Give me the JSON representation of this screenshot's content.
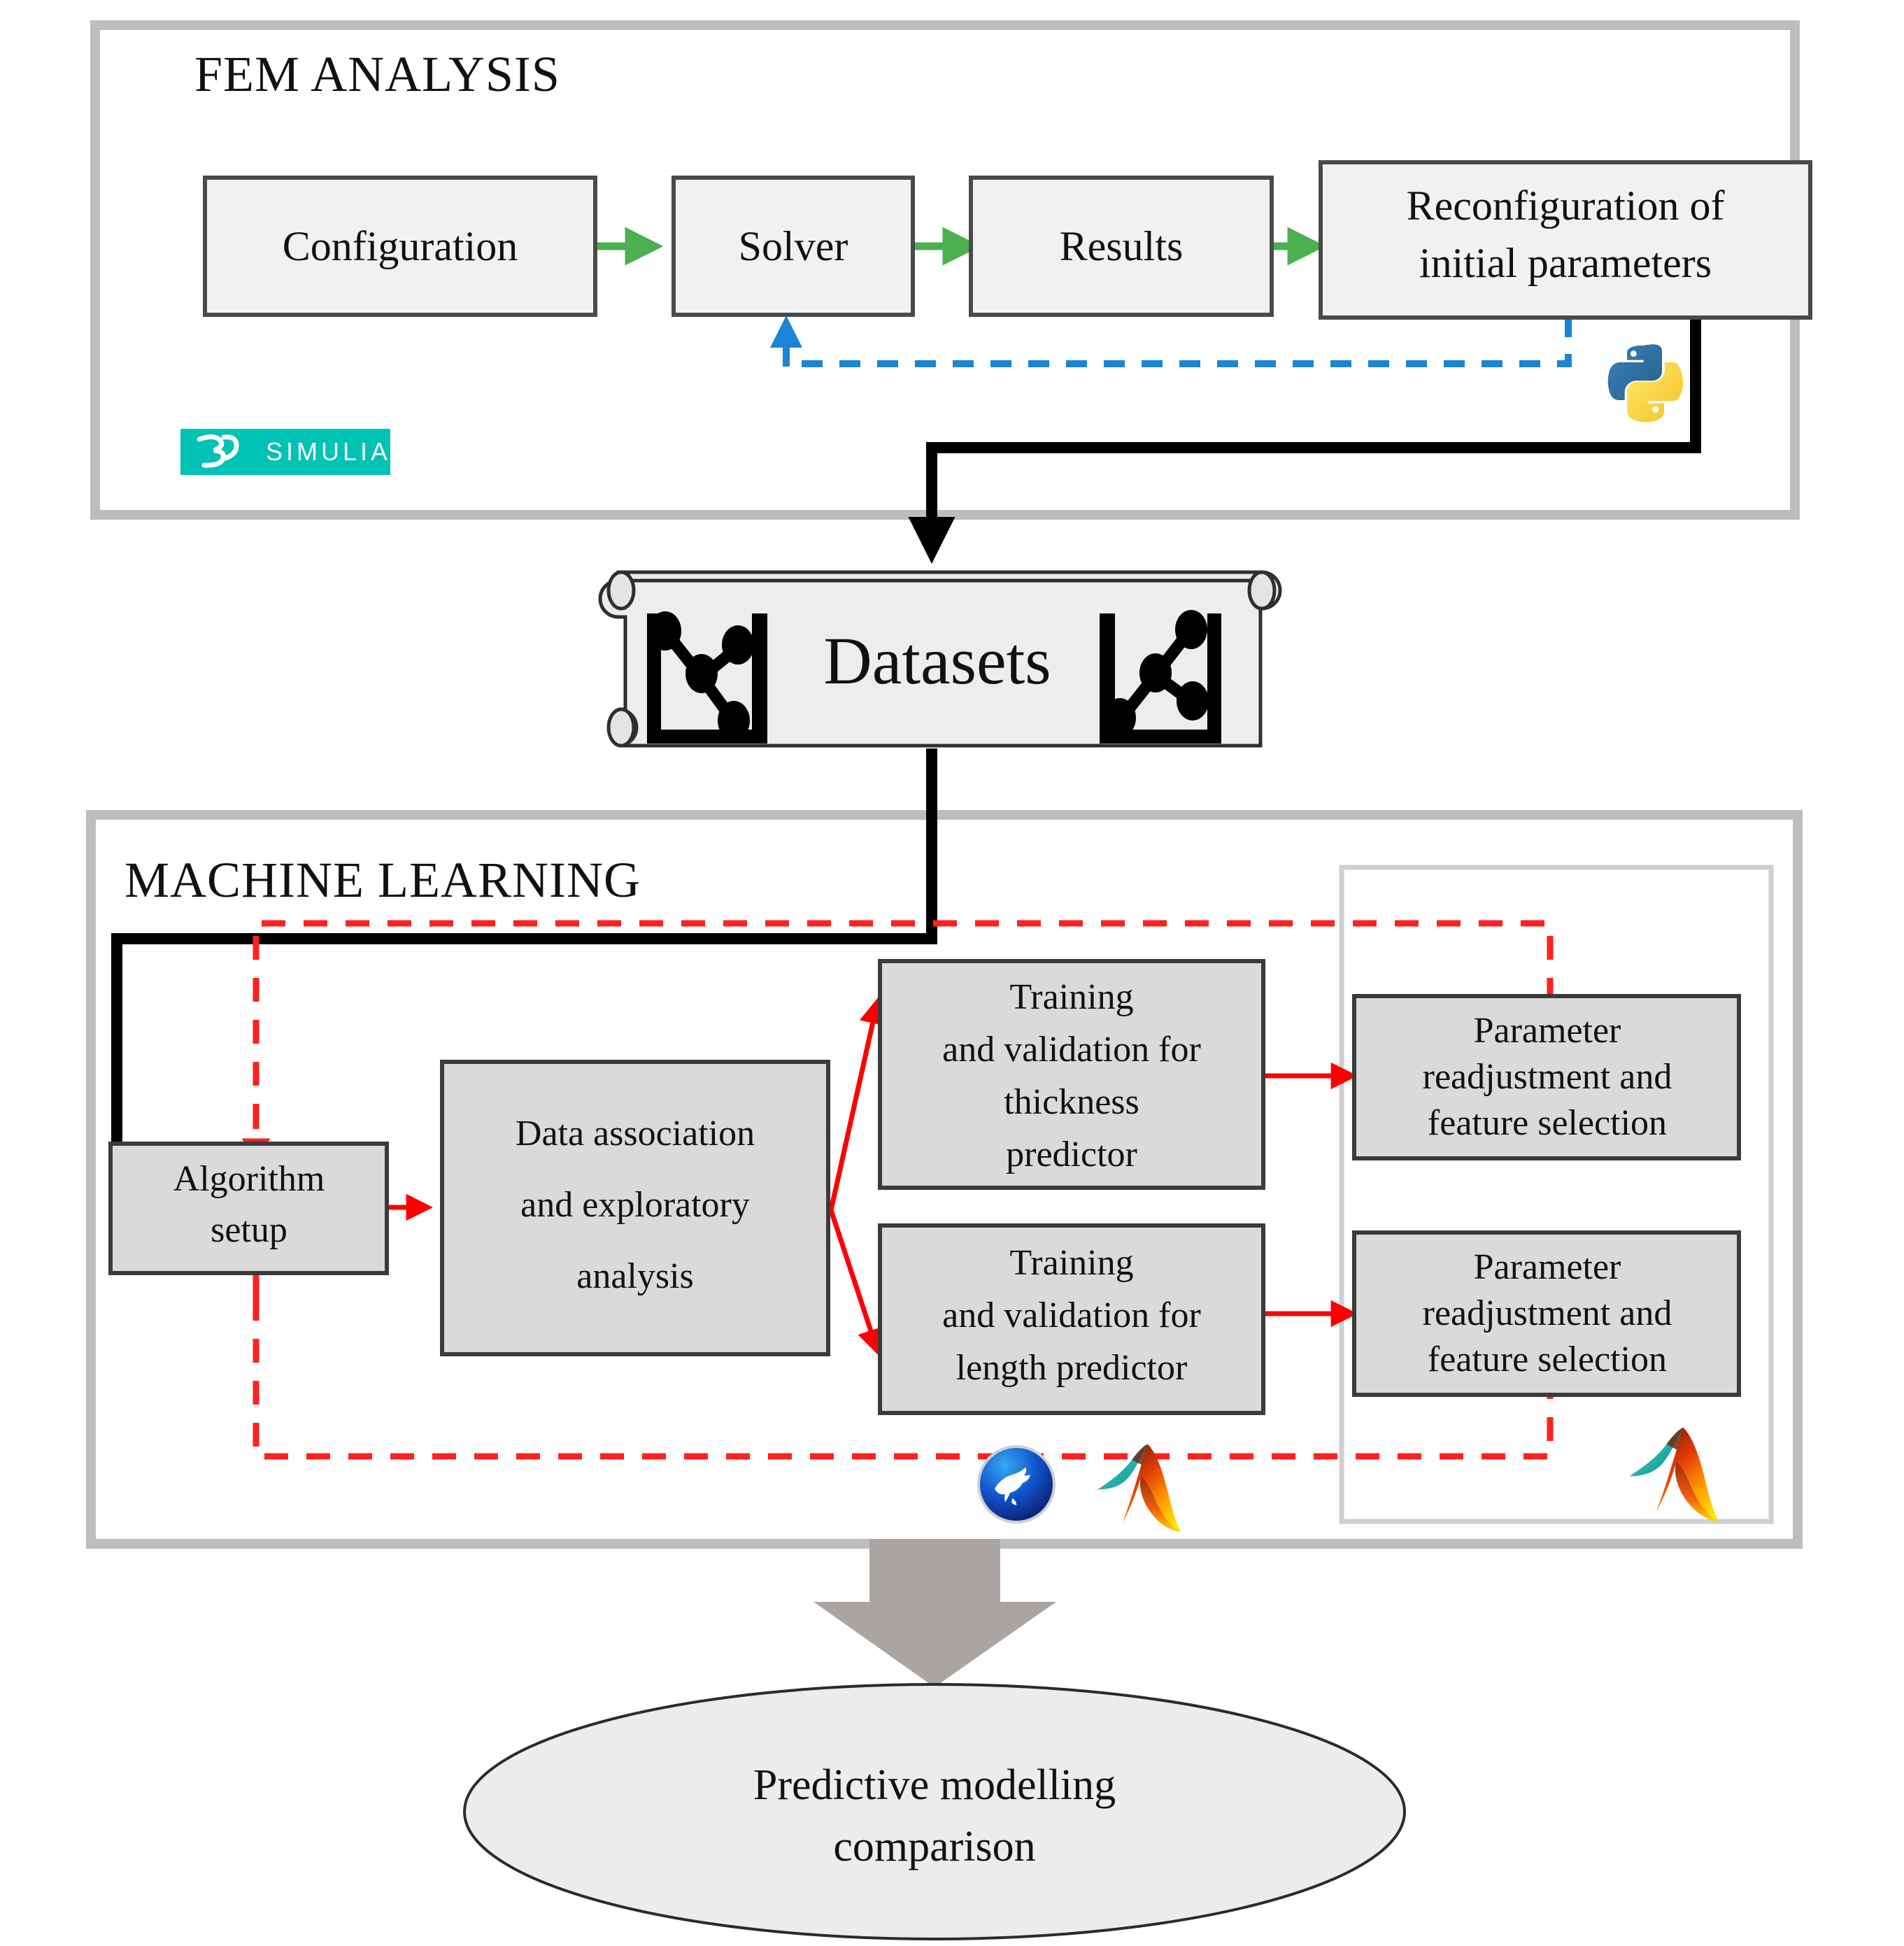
{
  "diagram": {
    "title_fem": "FEM ANALYSIS",
    "title_ml": "MACHINE LEARNING"
  },
  "fem": {
    "boxes": [
      {
        "id": "configuration",
        "label": "Configuration"
      },
      {
        "id": "solver",
        "label": "Solver"
      },
      {
        "id": "results",
        "label": "Results"
      },
      {
        "id": "reconfiguration",
        "line1": "Reconfiguration of",
        "line2": "initial parameters"
      }
    ],
    "logo": {
      "name": "simulia-logo",
      "mark": "3DS",
      "text": "SIMULIA",
      "color": "#00c2b5"
    },
    "python_logo": {
      "name": "python-logo",
      "blue": "#306998",
      "yellow": "#ffd43b"
    }
  },
  "datasets": {
    "label": "Datasets",
    "icon_left": "line-chart-icon",
    "icon_right": "line-chart-icon"
  },
  "ml": {
    "boxes": [
      {
        "id": "algorithm-setup",
        "line1": "Algorithm",
        "line2": "setup"
      },
      {
        "id": "data-association",
        "line1": "Data association",
        "line2": "and exploratory",
        "line3": "analysis"
      },
      {
        "id": "training-thickness",
        "line1": "Training",
        "line2": "and validation for",
        "line3": "thickness",
        "line4": "predictor"
      },
      {
        "id": "training-length",
        "line1": "Training",
        "line2": "and validation for",
        "line3": "length predictor"
      },
      {
        "id": "param-readjust-thickness",
        "line1": "Parameter",
        "line2": "readjustment and",
        "line3": "feature selection"
      },
      {
        "id": "param-readjust-length",
        "line1": "Parameter",
        "line2": "readjustment and",
        "line3": "feature selection"
      }
    ],
    "logos": [
      {
        "name": "weka-logo",
        "color": "#1565d8"
      },
      {
        "name": "matlab-logo",
        "color": "#e2591e"
      },
      {
        "name": "matlab-logo",
        "color": "#e2591e"
      }
    ]
  },
  "output": {
    "line1": "Predictive modelling",
    "line2": "comparison"
  },
  "colors": {
    "fem_box_fill": "#f1f1f1",
    "ml_box_fill": "#dadada",
    "frame_border": "#bdbdbd",
    "green_arrow": "#4caf50",
    "red_arrow": "#ff0000",
    "blue_dash": "#1a84d6",
    "black_flow": "#000000",
    "block_arrow": "#aaa5a2",
    "simulia_teal": "#00c2b5",
    "python_blue": "#306998",
    "python_yellow": "#ffd43b"
  }
}
